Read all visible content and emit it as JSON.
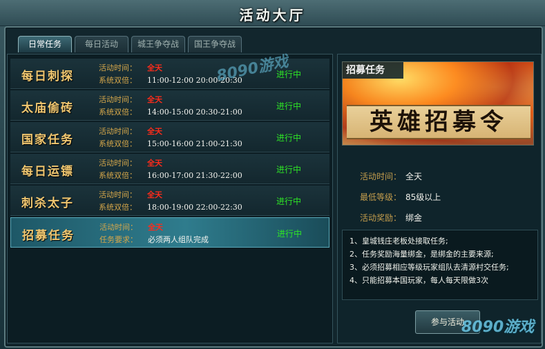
{
  "window": {
    "title": "活动大厅",
    "close_glyph": "×"
  },
  "tabs": [
    {
      "label": "日常任务",
      "active": true
    },
    {
      "label": "每日活动",
      "active": false
    },
    {
      "label": "城王争夺战",
      "active": false
    },
    {
      "label": "国王争夺战",
      "active": false
    }
  ],
  "tasks": [
    {
      "name": "每日刺探",
      "line1_label": "活动时间：",
      "line1_value": "全天",
      "line2_label": "系统双倍：",
      "line2_value": "11:00-12:00 20:00-20:30",
      "status": "进行中",
      "selected": false
    },
    {
      "name": "太庙偷砖",
      "line1_label": "活动时间：",
      "line1_value": "全天",
      "line2_label": "系统双倍：",
      "line2_value": "14:00-15:00 20:30-21:00",
      "status": "进行中",
      "selected": false
    },
    {
      "name": "国家任务",
      "line1_label": "活动时间：",
      "line1_value": "全天",
      "line2_label": "系统双倍：",
      "line2_value": "15:00-16:00 21:00-21:30",
      "status": "进行中",
      "selected": false
    },
    {
      "name": "每日运镖",
      "line1_label": "活动时间：",
      "line1_value": "全天",
      "line2_label": "系统双倍：",
      "line2_value": "16:00-17:00 21:30-22:00",
      "status": "进行中",
      "selected": false
    },
    {
      "name": "刺杀太子",
      "line1_label": "活动时间：",
      "line1_value": "全天",
      "line2_label": "系统双倍：",
      "line2_value": "18:00-19:00 22:00-22:30",
      "status": "进行中",
      "selected": false
    },
    {
      "name": "招募任务",
      "line1_label": "活动时间：",
      "line1_value": "全天",
      "line2_label": "任务要求：",
      "line2_value": "必须两人组队完成",
      "status": "进行中",
      "selected": true
    }
  ],
  "detail": {
    "banner_label": "招募任务",
    "banner_title": "英雄招募令",
    "time_label": "活动时间：",
    "time_value": "全天",
    "level_label": "最低等级：",
    "level_value": "85级以上",
    "reward_label": "活动奖励：",
    "reward_value": "绑金",
    "description": [
      "1、皇城钱庄老板处接取任务;",
      "2、任务奖励海量绑金，是绑金的主要来源;",
      "3、必须招募相应等级玩家组队去清源村交任务;",
      "4、只能招募本国玩家，每人每天限做3次"
    ],
    "join_button": "参与活动"
  },
  "watermarks": {
    "top": "8090游戏",
    "bottom": "8090游戏"
  },
  "colors": {
    "task_name": "#f1c770",
    "status_green": "#2ee626",
    "highlight_red": "#ff2b1a"
  }
}
